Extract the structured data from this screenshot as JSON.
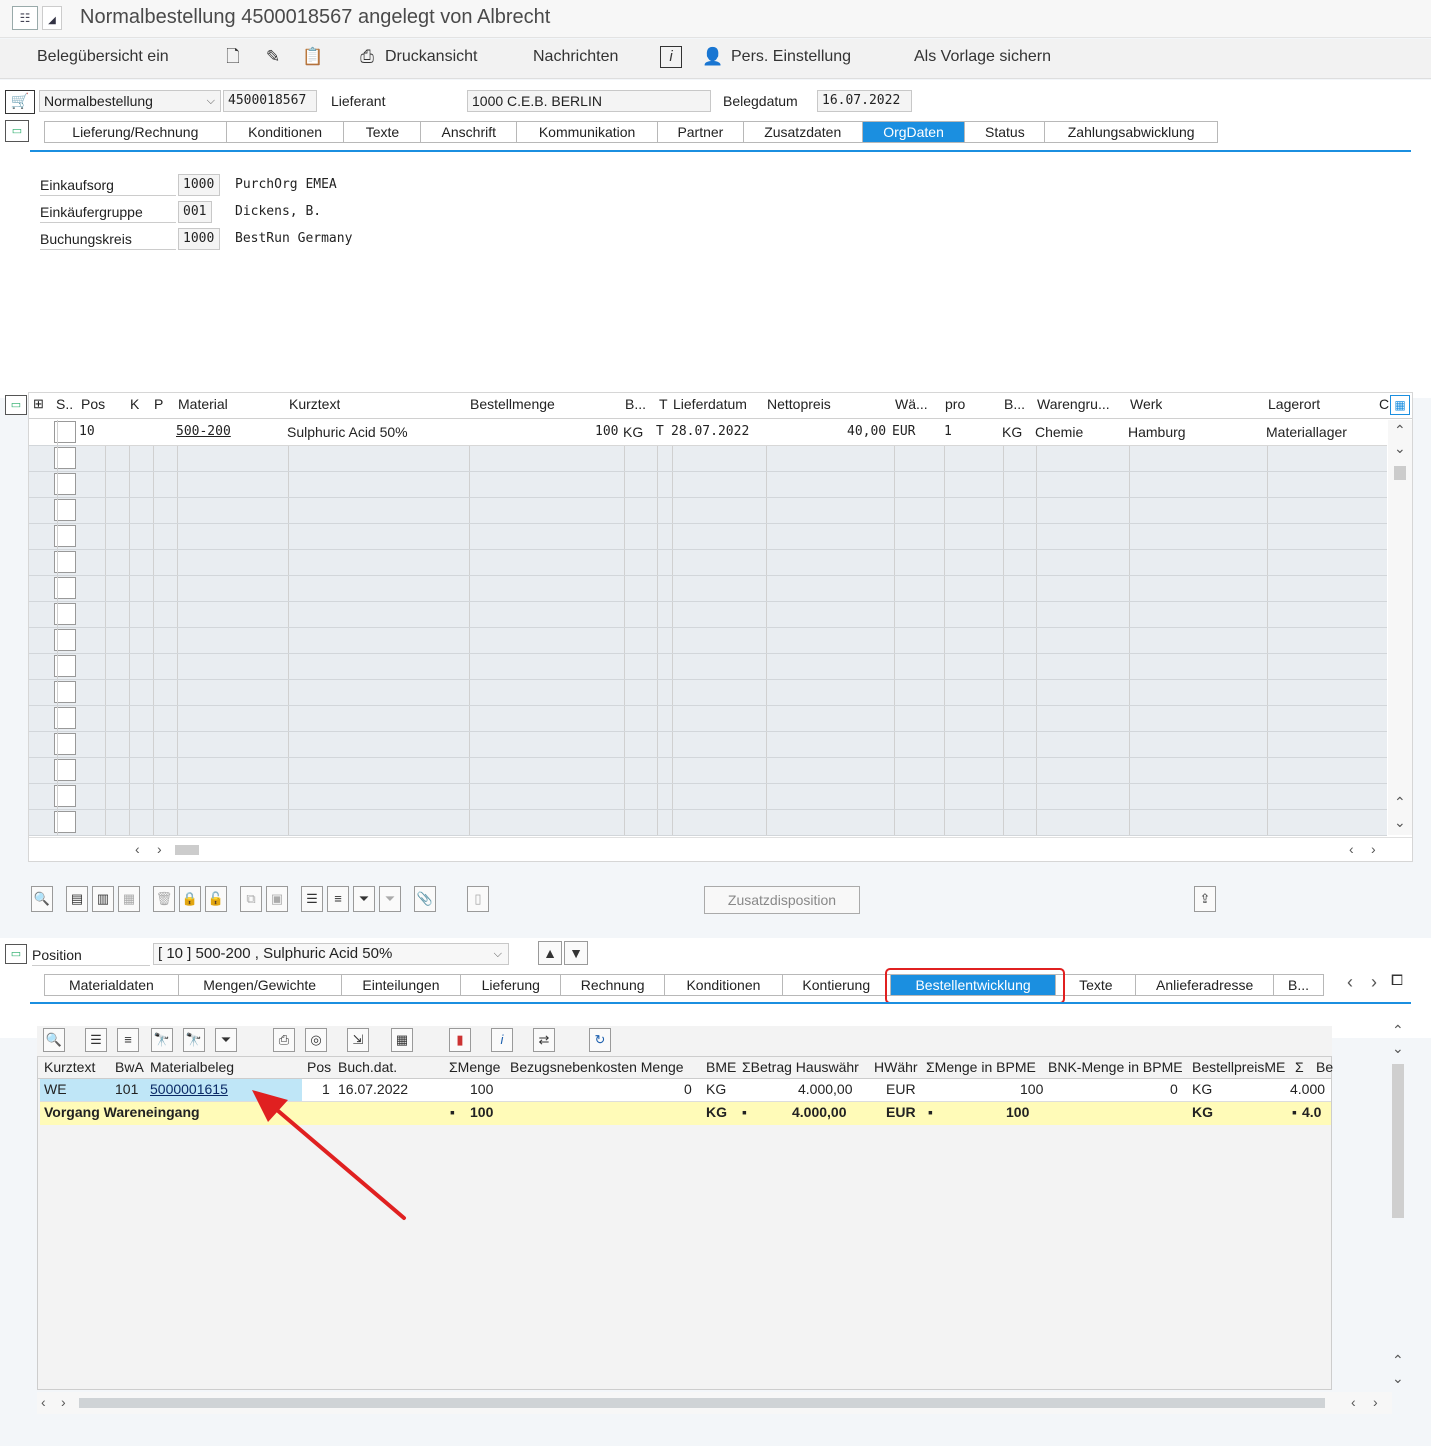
{
  "window": {
    "title": "Normalbestellung 4500018567 angelegt von Albrecht"
  },
  "toolbar": {
    "beleguebersicht": "Belegübersicht ein",
    "druckansicht": "Druckansicht",
    "nachrichten": "Nachrichten",
    "pers_einstellung": "Pers. Einstellung",
    "als_vorlage": "Als Vorlage sichern"
  },
  "header": {
    "doc_type": "Normalbestellung",
    "doc_number": "4500018567",
    "lieferant_label": "Lieferant",
    "lieferant_value": "1000 C.E.B. BERLIN",
    "belegdatum_label": "Belegdatum",
    "belegdatum_value": "16.07.2022",
    "tabs": [
      "Lieferung/Rechnung",
      "Konditionen",
      "Texte",
      "Anschrift",
      "Kommunikation",
      "Partner",
      "Zusatzdaten",
      "OrgDaten",
      "Status",
      "Zahlungsabwicklung"
    ],
    "active_tab": "OrgDaten",
    "org": [
      {
        "label": "Einkaufsorg",
        "code": "1000",
        "text": "PurchOrg EMEA"
      },
      {
        "label": "Einkäufergruppe",
        "code": "001",
        "text": "Dickens, B."
      },
      {
        "label": "Buchungskreis",
        "code": "1000",
        "text": "BestRun Germany"
      }
    ]
  },
  "items_table": {
    "columns": [
      "S..",
      "Pos",
      "K",
      "P",
      "Material",
      "Kurztext",
      "Bestellmenge",
      "B...",
      "T",
      "Lieferdatum",
      "Nettopreis",
      "Wä...",
      "pro",
      "B...",
      "Warengru...",
      "Werk",
      "Lagerort",
      "C"
    ],
    "rows": [
      {
        "pos": "10",
        "material": "500-200",
        "kurztext": "Sulphuric Acid 50%",
        "bestellmenge": "100",
        "bme": "KG",
        "t": "T",
        "lieferdatum": "28.07.2022",
        "nettopreis": "40,00",
        "waehrung": "EUR",
        "pro": "1",
        "bpme": "KG",
        "warengruppe": "Chemie",
        "werk": "Hamburg",
        "lagerort": "Materiallager"
      }
    ]
  },
  "buttons": {
    "zusatzdisposition": "Zusatzdisposition"
  },
  "item_detail": {
    "position_label": "Position",
    "position_value": "[ 10 ] 500-200 , Sulphuric Acid 50%",
    "tabs": [
      "Materialdaten",
      "Mengen/Gewichte",
      "Einteilungen",
      "Lieferung",
      "Rechnung",
      "Konditionen",
      "Kontierung",
      "Bestellentwicklung",
      "Texte",
      "Anlieferadresse",
      "B..."
    ],
    "active_tab": "Bestellentwicklung",
    "highlight_color": "#e02020"
  },
  "history": {
    "columns": [
      "Kurztext",
      "BwA",
      "Materialbeleg",
      "Pos",
      "Buch.dat.",
      "ΣMenge",
      "Bezugsnebenkosten Menge",
      "BME",
      "ΣBetrag Hauswähr",
      "HWähr",
      "ΣMenge in BPME",
      "BNK-Menge in BPME",
      "BestellpreisME",
      "Σ",
      "Be"
    ],
    "row": {
      "kurztext": "WE",
      "bwa": "101",
      "materialbeleg": "5000001615",
      "pos": "1",
      "buchdat": "16.07.2022",
      "menge": "100",
      "bnk_menge": "0",
      "bme": "KG",
      "betrag": "4.000,00",
      "hwaehr": "EUR",
      "menge_bpme": "100",
      "bnk_bpme": "0",
      "bestellpreisme": "KG",
      "be": "4.000"
    },
    "total": {
      "label": "Vorgang Wareneingang",
      "dot": "▪",
      "menge": "100",
      "bme": "KG",
      "betrag": "4.000,00",
      "hwaehr": "EUR",
      "menge_bpme": "100",
      "bestellpreisme": "KG",
      "be": "4.0"
    }
  },
  "colors": {
    "accent": "#1b8fe0",
    "total_row": "#fffbb8",
    "selected_row": "#bfe6f7",
    "arrow": "#e02020"
  }
}
